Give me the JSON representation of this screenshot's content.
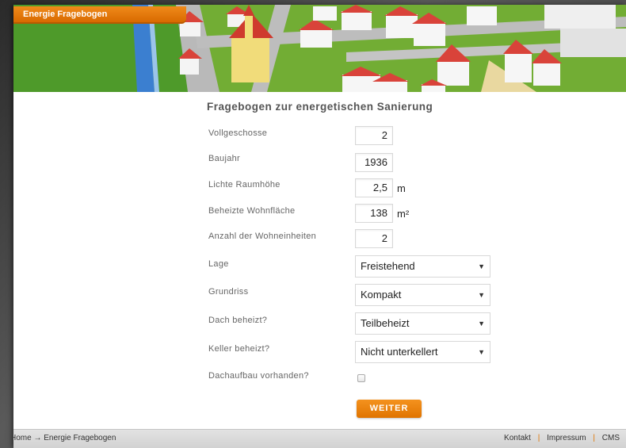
{
  "header": {
    "brand": "Energie Fragebogen"
  },
  "form": {
    "title": "Fragebogen zur energetischen Sanierung",
    "fields": [
      {
        "label": "Vollgeschosse",
        "value": "2",
        "unit": ""
      },
      {
        "label": "Baujahr",
        "value": "1936",
        "unit": ""
      },
      {
        "label": "Lichte Raumhöhe",
        "value": "2,5",
        "unit": "m"
      },
      {
        "label": "Beheizte Wohnfläche",
        "value": "138",
        "unit": "m²"
      },
      {
        "label": "Anzahl der Wohneinheiten",
        "value": "2",
        "unit": ""
      }
    ],
    "selects": [
      {
        "label": "Lage",
        "value": "Freistehend"
      },
      {
        "label": "Grundriss",
        "value": "Kompakt"
      },
      {
        "label": "Dach beheizt?",
        "value": "Teilbeheizt"
      },
      {
        "label": "Keller beheizt?",
        "value": "Nicht unterkellert"
      }
    ],
    "checkbox": {
      "label": "Dachaufbau vorhanden?",
      "checked": false
    },
    "submit_label": "WEITER"
  },
  "footer": {
    "breadcrumb": "Home → Energie Fragebogen",
    "links": [
      "Kontakt",
      "Impressum",
      "CMS"
    ],
    "separator": "|"
  },
  "icons": {
    "select_chevron": "▼"
  },
  "colors": {
    "accent": "#e07400",
    "grass": "#6fa832",
    "roof": "#d9433a"
  }
}
